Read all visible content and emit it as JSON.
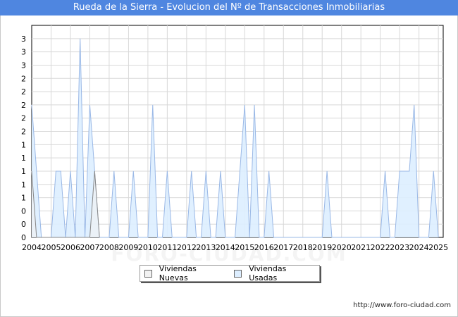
{
  "title": "Rueda de la Sierra - Evolucion del Nº de Transacciones Inmobiliarias",
  "footer_url": "http://www.foro-ciudad.com",
  "watermark": "FORO-CIUDAD.COM",
  "colors": {
    "title_bg": "#4f86e0",
    "nuevas_fill": "#f2f2f2",
    "nuevas_line": "#888888",
    "usadas_fill": "#ddeeff",
    "usadas_line": "#9ab8e6",
    "grid": "#d8d8d8"
  },
  "chart_data": {
    "type": "area",
    "title": "Rueda de la Sierra - Evolucion del Nº de Transacciones Inmobiliarias",
    "xlabel": "",
    "ylabel": "",
    "ylim": [
      0,
      3.2
    ],
    "y_ticks": [
      0,
      0.2,
      0.4,
      0.6,
      0.8,
      1.0,
      1.2,
      1.4,
      1.6,
      1.8,
      2.0,
      2.2,
      2.4,
      2.6,
      2.8,
      3.0,
      3.2
    ],
    "y_tick_labels": [
      "0",
      "0",
      "0",
      "1",
      "1",
      "1",
      "1",
      "1",
      "2",
      "2",
      "2",
      "2",
      "2",
      "3",
      "3",
      "3",
      "3"
    ],
    "x_tick_labels": [
      "2004",
      "2005",
      "2006",
      "2007",
      "2008",
      "2009",
      "2010",
      "2011",
      "2012",
      "2013",
      "2014",
      "2015",
      "2016",
      "2017",
      "2018",
      "2019",
      "2020",
      "2021",
      "2022",
      "2023",
      "2024",
      "2025"
    ],
    "x_range": [
      2004,
      2025.25
    ],
    "grid": true,
    "legend_position": "bottom-center",
    "series": [
      {
        "name": "Viviendas Nuevas",
        "points": [
          [
            2004,
            1
          ],
          [
            2004.25,
            0
          ],
          [
            2007,
            0
          ],
          [
            2007.25,
            1
          ],
          [
            2007.5,
            0
          ]
        ]
      },
      {
        "name": "Viviendas Usadas",
        "points": [
          [
            2004,
            2
          ],
          [
            2004.25,
            1
          ],
          [
            2004.5,
            0
          ],
          [
            2005,
            0
          ],
          [
            2005.25,
            1
          ],
          [
            2005.5,
            1
          ],
          [
            2005.75,
            0
          ],
          [
            2006,
            1
          ],
          [
            2006.25,
            0
          ],
          [
            2006.5,
            3
          ],
          [
            2006.75,
            0
          ],
          [
            2007,
            2
          ],
          [
            2007.25,
            1
          ],
          [
            2007.5,
            0
          ],
          [
            2008,
            0
          ],
          [
            2008.25,
            1
          ],
          [
            2008.5,
            0
          ],
          [
            2009,
            0
          ],
          [
            2009.25,
            1
          ],
          [
            2009.5,
            0
          ],
          [
            2010,
            0
          ],
          [
            2010.25,
            2
          ],
          [
            2010.5,
            0
          ],
          [
            2010.75,
            0
          ],
          [
            2011,
            1
          ],
          [
            2011.25,
            0
          ],
          [
            2012,
            0
          ],
          [
            2012.25,
            1
          ],
          [
            2012.5,
            0
          ],
          [
            2012.75,
            0
          ],
          [
            2013,
            1
          ],
          [
            2013.25,
            0
          ],
          [
            2013.5,
            0
          ],
          [
            2013.75,
            1
          ],
          [
            2014,
            0
          ],
          [
            2014.5,
            0
          ],
          [
            2014.75,
            1
          ],
          [
            2015,
            2
          ],
          [
            2015.25,
            0
          ],
          [
            2015.5,
            2
          ],
          [
            2015.75,
            0
          ],
          [
            2016,
            0
          ],
          [
            2016.25,
            1
          ],
          [
            2016.5,
            0
          ],
          [
            2017,
            0
          ],
          [
            2019,
            0
          ],
          [
            2019.25,
            1
          ],
          [
            2019.5,
            0
          ],
          [
            2022,
            0
          ],
          [
            2022.25,
            1
          ],
          [
            2022.5,
            0
          ],
          [
            2022.75,
            0
          ],
          [
            2023,
            1
          ],
          [
            2023.25,
            1
          ],
          [
            2023.5,
            1
          ],
          [
            2023.75,
            2
          ],
          [
            2024,
            0
          ],
          [
            2024.5,
            0
          ],
          [
            2024.75,
            1
          ],
          [
            2025,
            0
          ]
        ]
      }
    ]
  }
}
